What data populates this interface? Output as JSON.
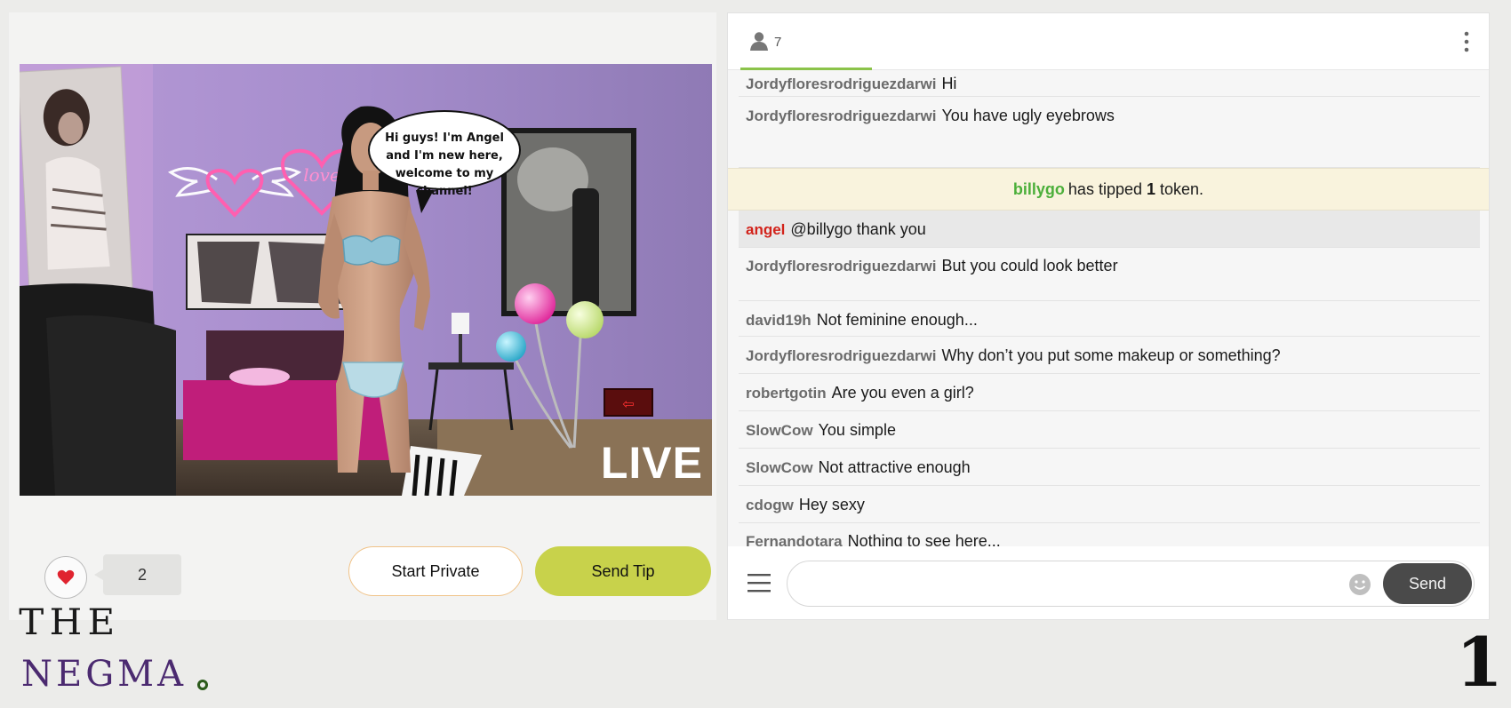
{
  "stream": {
    "speech_bubble": "Hi guys! I'm Angel and I'm new here, welcome to my channel!",
    "live_label": "LIVE",
    "neon_sign_text": "love",
    "like_count": "2",
    "start_private_label": "Start Private",
    "send_tip_label": "Send Tip",
    "accent_color": "#c8d24b",
    "private_border_color": "#f0c389"
  },
  "chat": {
    "viewer_count": "7",
    "messages": [
      {
        "user": "Jordyfloresrodriguezdarwi",
        "text": "Hi"
      },
      {
        "user": "Jordyfloresrodriguezdarwi",
        "text": "You have ugly eyebrows"
      },
      {
        "user": "angel",
        "text": "@billygo  thank you"
      },
      {
        "user": "Jordyfloresrodriguezdarwi",
        "text": "But you could look better"
      },
      {
        "user": "david19h",
        "text": "Not feminine enough..."
      },
      {
        "user": "Jordyfloresrodriguezdarwi",
        "text": "Why don’t you put some makeup or something?"
      },
      {
        "user": "robertgotin",
        "text": "Are you even a girl?"
      },
      {
        "user": "SlowCow",
        "text": "You simple"
      },
      {
        "user": "SlowCow",
        "text": "Not attractive enough"
      },
      {
        "user": "cdogw",
        "text": "Hey sexy"
      },
      {
        "user": "Fernandotara",
        "text": "Nothing to see here..."
      }
    ],
    "tip": {
      "user": "billygo",
      "prefix": "has tipped",
      "amount": "1",
      "suffix": "token."
    },
    "input_placeholder": "",
    "send_label": "Send",
    "host_name_color": "#d2231b",
    "tip_user_color": "#4caf3a"
  },
  "watermark": {
    "line1": "THE",
    "line2": "NEGMA"
  },
  "page_number": "1"
}
